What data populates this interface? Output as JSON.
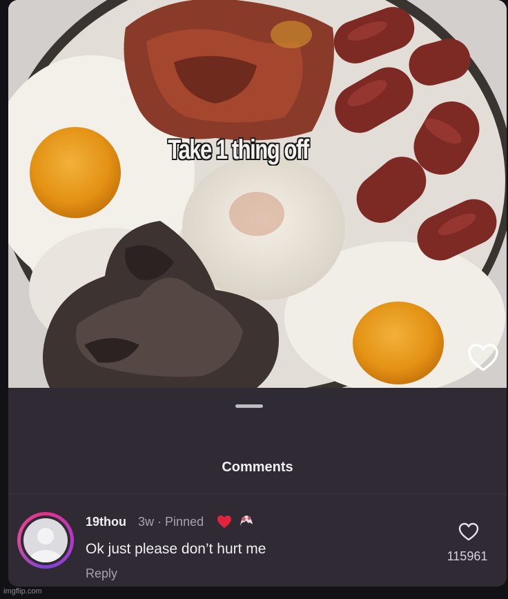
{
  "post": {
    "overlay_caption": "Take 1 thing off",
    "photo_like_icon": "heart-outline-icon"
  },
  "comments_sheet": {
    "title": "Comments",
    "comment": {
      "username": "19thou",
      "age": "3w",
      "separator": "·",
      "pinned_label": "Pinned",
      "creator_liked_icon": "red-heart-icon",
      "text": "Ok just please don’t hurt me",
      "reply_label": "Reply",
      "like_icon": "heart-outline-icon",
      "like_count": "115961"
    }
  },
  "watermark": "imgflip.com",
  "colors": {
    "sheet_background": "#2f2a33",
    "heart_red": "#e0243c",
    "avatar_ring": "#d13a9a"
  }
}
